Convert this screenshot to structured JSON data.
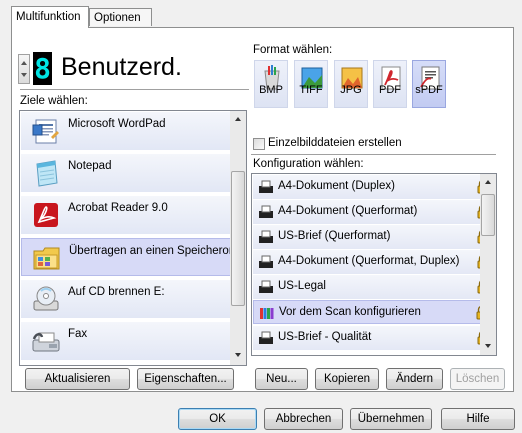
{
  "tabs": [
    {
      "label": "Multifunktion",
      "active": true
    },
    {
      "label": "Optionen",
      "active": false
    }
  ],
  "counter": {
    "digit": "8"
  },
  "profile_name": "Benutzerd.",
  "destinations": {
    "label": "Ziele wählen:",
    "items": [
      {
        "label": "Microsoft WordPad",
        "icon": "wordpad-icon"
      },
      {
        "label": "Notepad",
        "icon": "notepad-icon"
      },
      {
        "label": "Acrobat Reader 9.0",
        "icon": "acrobat-icon"
      },
      {
        "label": "Übertragen an einen Speicherort",
        "icon": "folder-icon",
        "selected": true
      },
      {
        "label": "Auf CD brennen  E:",
        "icon": "cd-burn-icon"
      },
      {
        "label": "Fax",
        "icon": "fax-icon"
      }
    ]
  },
  "format": {
    "label": "Format wählen:",
    "items": [
      {
        "label": "BMP",
        "icon": "bmp-icon"
      },
      {
        "label": "TIFF",
        "icon": "tiff-icon"
      },
      {
        "label": "JPG",
        "icon": "jpg-icon"
      },
      {
        "label": "PDF",
        "icon": "pdf-icon"
      },
      {
        "label": "sPDF",
        "icon": "spdf-icon",
        "selected": true
      }
    ]
  },
  "single_files_checkbox": {
    "label": "Einzelbilddateien erstellen",
    "checked": false
  },
  "configuration": {
    "label": "Konfiguration wählen:",
    "items": [
      {
        "label": "A4-Dokument (Duplex)",
        "locked": true
      },
      {
        "label": "A4-Dokument (Querformat)",
        "locked": true
      },
      {
        "label": "US-Brief (Querformat)",
        "locked": true
      },
      {
        "label": "A4-Dokument (Querformat, Duplex)",
        "locked": true
      },
      {
        "label": "US-Legal",
        "locked": true
      },
      {
        "label": "Vor dem Scan konfigurieren",
        "locked": true,
        "selected": true
      },
      {
        "label": "US-Brief - Qualität",
        "locked": true
      }
    ]
  },
  "buttons": {
    "refresh": "Aktualisieren",
    "properties": "Eigenschaften...",
    "new": "Neu...",
    "copy": "Kopieren",
    "change": "Ändern",
    "delete": "Löschen",
    "ok": "OK",
    "cancel": "Abbrechen",
    "apply": "Übernehmen",
    "help": "Hilfe"
  },
  "colors": {
    "selection": "#d7daf7",
    "list_item": "#e6eaf6",
    "digit": "#00e5e5",
    "lock": "#e6b422"
  }
}
